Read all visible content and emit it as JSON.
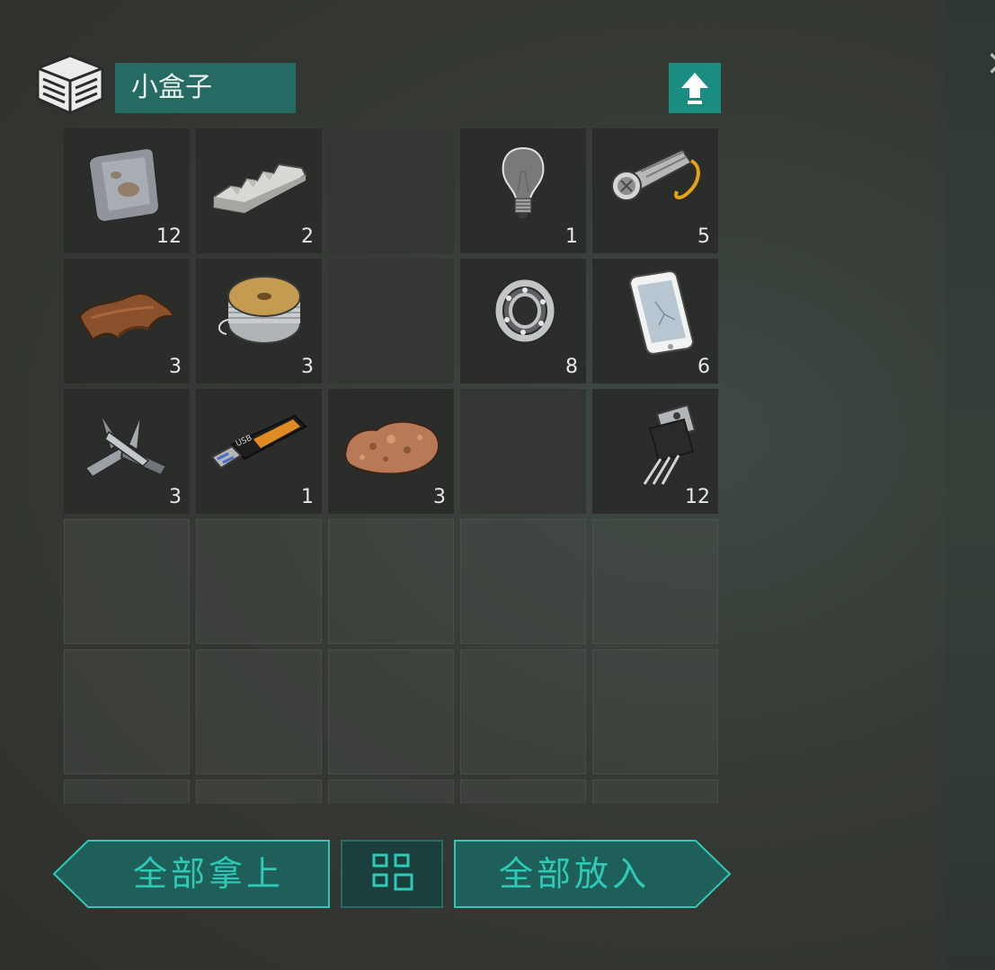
{
  "container": {
    "title": "小盒子",
    "icon": "box-icon",
    "upload_icon": "upload-arrow-icon",
    "close_icon": "close-icon"
  },
  "inventory": {
    "slots": [
      {
        "item": "metal-plate-icon",
        "count": "12"
      },
      {
        "item": "metal-ingot-icon",
        "count": "2"
      },
      {
        "item": null,
        "count": ""
      },
      {
        "item": "light-bulb-icon",
        "count": "1"
      },
      {
        "item": "flashlight-icon",
        "count": "5"
      },
      {
        "item": "leather-icon",
        "count": "3"
      },
      {
        "item": "wire-spool-icon",
        "count": "3"
      },
      {
        "item": null,
        "count": ""
      },
      {
        "item": "bearing-icon",
        "count": "8"
      },
      {
        "item": "smartphone-icon",
        "count": "6"
      },
      {
        "item": "metal-scrap-icon",
        "count": "3"
      },
      {
        "item": "usb-drive-icon",
        "count": "1"
      },
      {
        "item": "copper-ore-icon",
        "count": "3"
      },
      {
        "item": null,
        "count": ""
      },
      {
        "item": "transistor-icon",
        "count": "12"
      }
    ],
    "usb_text": "USB"
  },
  "actions": {
    "take_all": "全部拿上",
    "put_all": "全部放入",
    "grid_toggle_icon": "grid-layout-icon"
  },
  "colors": {
    "accent": "#2fc9b6",
    "title_bg": "#256a63",
    "button_bg": "#1e5f5a",
    "slot_bg": "#2b2d2b"
  }
}
